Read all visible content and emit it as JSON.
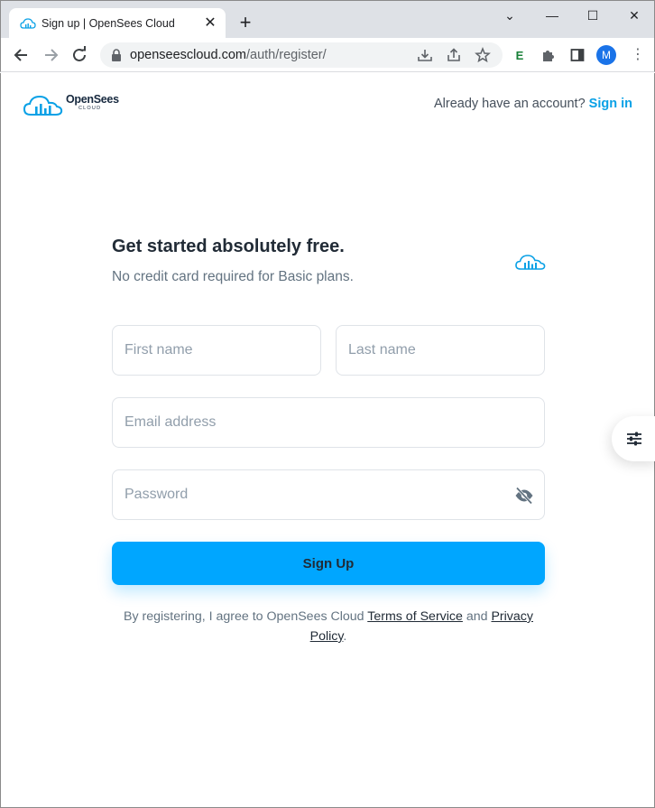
{
  "browser": {
    "tab_title": "Sign up | OpenSees Cloud",
    "tab_close": "✕",
    "new_tab": "+",
    "url_host": "openseescloud.com",
    "url_path": "/auth/register/",
    "avatar_letter": "M",
    "menu_glyph": "⋮",
    "window_controls": {
      "minimize": "—",
      "maximize": "☐",
      "close": "✕",
      "dropdown": "⌄"
    }
  },
  "header": {
    "logo_text": "OpenSees",
    "logo_subtext": "CLOUD",
    "have_account": "Already have an account?",
    "signin_label": "Sign in"
  },
  "form": {
    "heading": "Get started absolutely free.",
    "subheading": "No credit card required for Basic plans.",
    "first_name_placeholder": "First name",
    "last_name_placeholder": "Last name",
    "email_placeholder": "Email address",
    "password_placeholder": "Password",
    "submit_label": "Sign Up"
  },
  "terms": {
    "prefix": "By registering, I agree to OpenSees Cloud ",
    "tos_label": "Terms of Service",
    "and": " and ",
    "privacy_label": "Privacy Policy",
    "suffix": "."
  },
  "colors": {
    "accent": "#00a6ff",
    "link": "#0aa1e6",
    "heading": "#212b36",
    "muted": "#637381",
    "border": "#dfe3e8"
  },
  "icons": [
    "cloud-logo-icon",
    "lock-icon",
    "eye-off-icon",
    "settings-sliders-icon",
    "back-arrow-icon",
    "forward-arrow-icon",
    "reload-icon",
    "download-icon",
    "share-icon",
    "star-icon",
    "extension-e-icon",
    "puzzle-icon",
    "sidepanel-icon"
  ]
}
